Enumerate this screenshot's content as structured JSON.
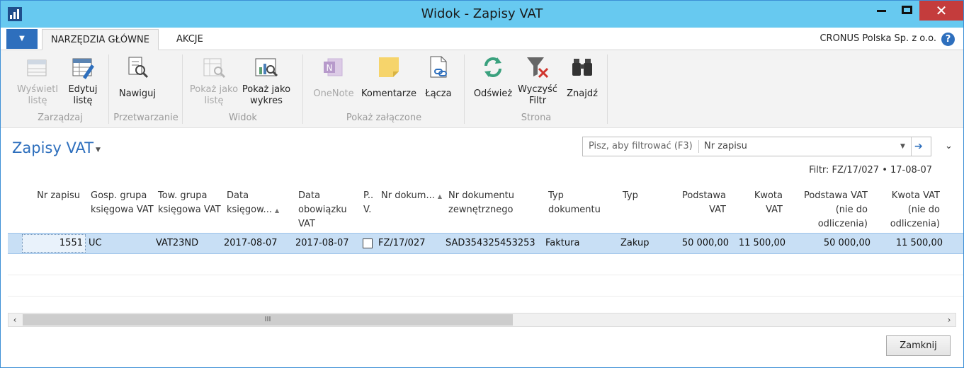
{
  "window": {
    "title": "Widok - Zapisy VAT",
    "close_glyph": "✕"
  },
  "ribbon_tabs": {
    "home": "NARZĘDZIA GŁÓWNE",
    "actions": "AKCJE"
  },
  "company": "CRONUS Polska Sp. z o.o.",
  "help_glyph": "?",
  "ribbon": {
    "view_list": "Wyświetl listę",
    "edit_list": "Edytuj listę",
    "navigate": "Nawiguj",
    "show_as_list": "Pokaż jako listę",
    "show_as_chart": "Pokaż jako wykres",
    "onenote": "OneNote",
    "comments": "Komentarze",
    "links": "Łącza",
    "refresh": "Odśwież",
    "clear_filter": "Wyczyść Filtr",
    "find": "Znajdź",
    "groups": {
      "manage": "Zarządzaj",
      "process": "Przetwarzanie",
      "view": "Widok",
      "attachments": "Pokaż załączone",
      "page": "Strona"
    }
  },
  "page": {
    "title": "Zapisy VAT"
  },
  "filter": {
    "placeholder": "Pisz, aby filtrować (F3)",
    "field": "Nr zapisu",
    "summary": "Filtr: FZ/17/027 • 17-08-07"
  },
  "columns": {
    "entry_no": "Nr zapisu",
    "vat_bus_group": "Gosp. grupa księgowa VAT",
    "vat_prod_group": "Tow. grupa księgowa VAT",
    "posting_date": "Data księgow...",
    "vat_date": "Data obowiązku VAT",
    "p_v": "P.. V.",
    "doc_no": "Nr dokum...",
    "ext_doc_no": "Nr dokumentu zewnętrznego",
    "doc_type": "Typ dokumentu",
    "type": "Typ",
    "base": "Podstawa VAT",
    "amount": "Kwota VAT",
    "base_nd": "Podstawa VAT (nie do odliczenia)",
    "amount_nd": "Kwota VAT (nie do odliczenia)"
  },
  "rows": [
    {
      "entry_no": "1551",
      "vat_bus_group": "UC",
      "vat_prod_group": "VAT23ND",
      "posting_date": "2017-08-07",
      "vat_date": "2017-08-07",
      "doc_no": "FZ/17/027",
      "ext_doc_no": "SAD354325453253",
      "doc_type": "Faktura",
      "type": "Zakup",
      "base": "50 000,00",
      "amount": "11 500,00",
      "base_nd": "50 000,00",
      "amount_nd": "11 500,00"
    }
  ],
  "scroll_grip": "III",
  "close_button": "Zamknij"
}
